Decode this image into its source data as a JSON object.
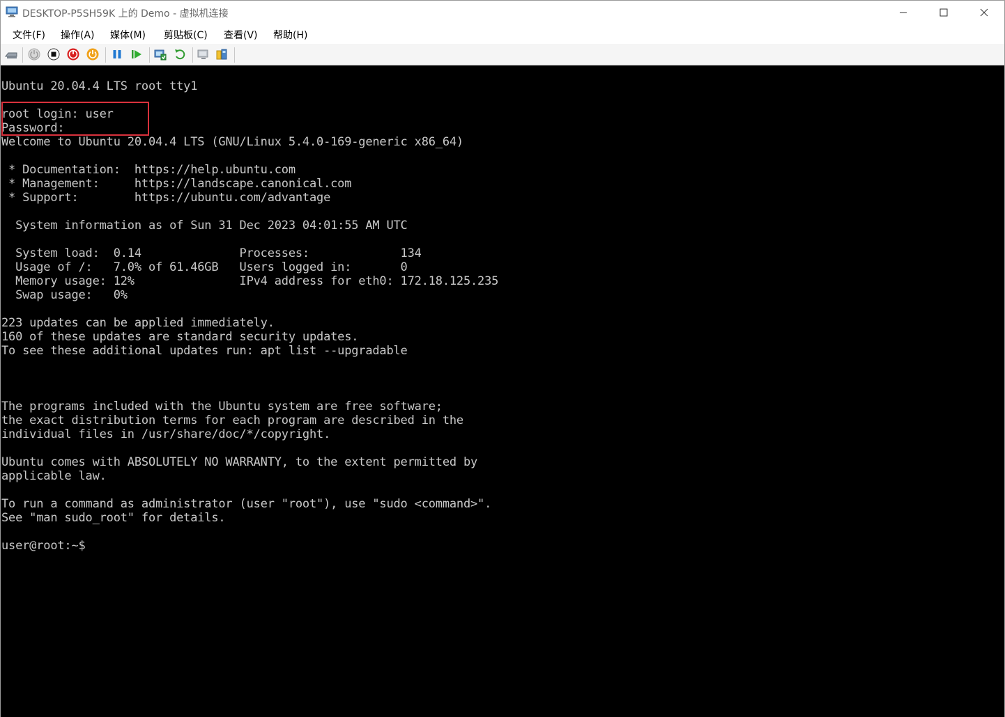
{
  "window": {
    "title": "DESKTOP-P5SH59K 上的 Demo - 虚拟机连接",
    "minimize_label": "─",
    "maximize_label": "☐",
    "close_label": "✕"
  },
  "menu": {
    "items": [
      "文件(F)",
      "操作(A)",
      "媒体(M)",
      "剪贴板(C)",
      "查看(V)",
      "帮助(H)"
    ]
  },
  "toolbar": {
    "buttons": [
      {
        "icon": "ctrl-alt-del-icon"
      },
      {
        "icon": "start-icon"
      },
      {
        "icon": "turn-off-icon"
      },
      {
        "icon": "shut-down-icon"
      },
      {
        "icon": "save-icon"
      },
      {
        "icon": "pause-icon"
      },
      {
        "icon": "resume-icon"
      },
      {
        "icon": "checkpoint-icon"
      },
      {
        "icon": "revert-icon"
      },
      {
        "icon": "enhanced-session-icon"
      },
      {
        "icon": "share-icon"
      }
    ]
  },
  "console": {
    "lines": [
      "Ubuntu 20.04.4 LTS root tty1",
      "",
      "root login: user",
      "Password:",
      "Welcome to Ubuntu 20.04.4 LTS (GNU/Linux 5.4.0-169-generic x86_64)",
      "",
      " * Documentation:  https://help.ubuntu.com",
      " * Management:     https://landscape.canonical.com",
      " * Support:        https://ubuntu.com/advantage",
      "",
      "  System information as of Sun 31 Dec 2023 04:01:55 AM UTC",
      "",
      "  System load:  0.14              Processes:             134",
      "  Usage of /:   7.0% of 61.46GB   Users logged in:       0",
      "  Memory usage: 12%               IPv4 address for eth0: 172.18.125.235",
      "  Swap usage:   0%",
      "",
      "223 updates can be applied immediately.",
      "160 of these updates are standard security updates.",
      "To see these additional updates run: apt list --upgradable",
      "",
      "",
      "",
      "The programs included with the Ubuntu system are free software;",
      "the exact distribution terms for each program are described in the",
      "individual files in /usr/share/doc/*/copyright.",
      "",
      "Ubuntu comes with ABSOLUTELY NO WARRANTY, to the extent permitted by",
      "applicable law.",
      "",
      "To run a command as administrator (user \"root\"), use \"sudo <command>\".",
      "See \"man sudo_root\" for details.",
      "",
      "user@root:~$"
    ],
    "highlight_color": "#d9313c"
  }
}
